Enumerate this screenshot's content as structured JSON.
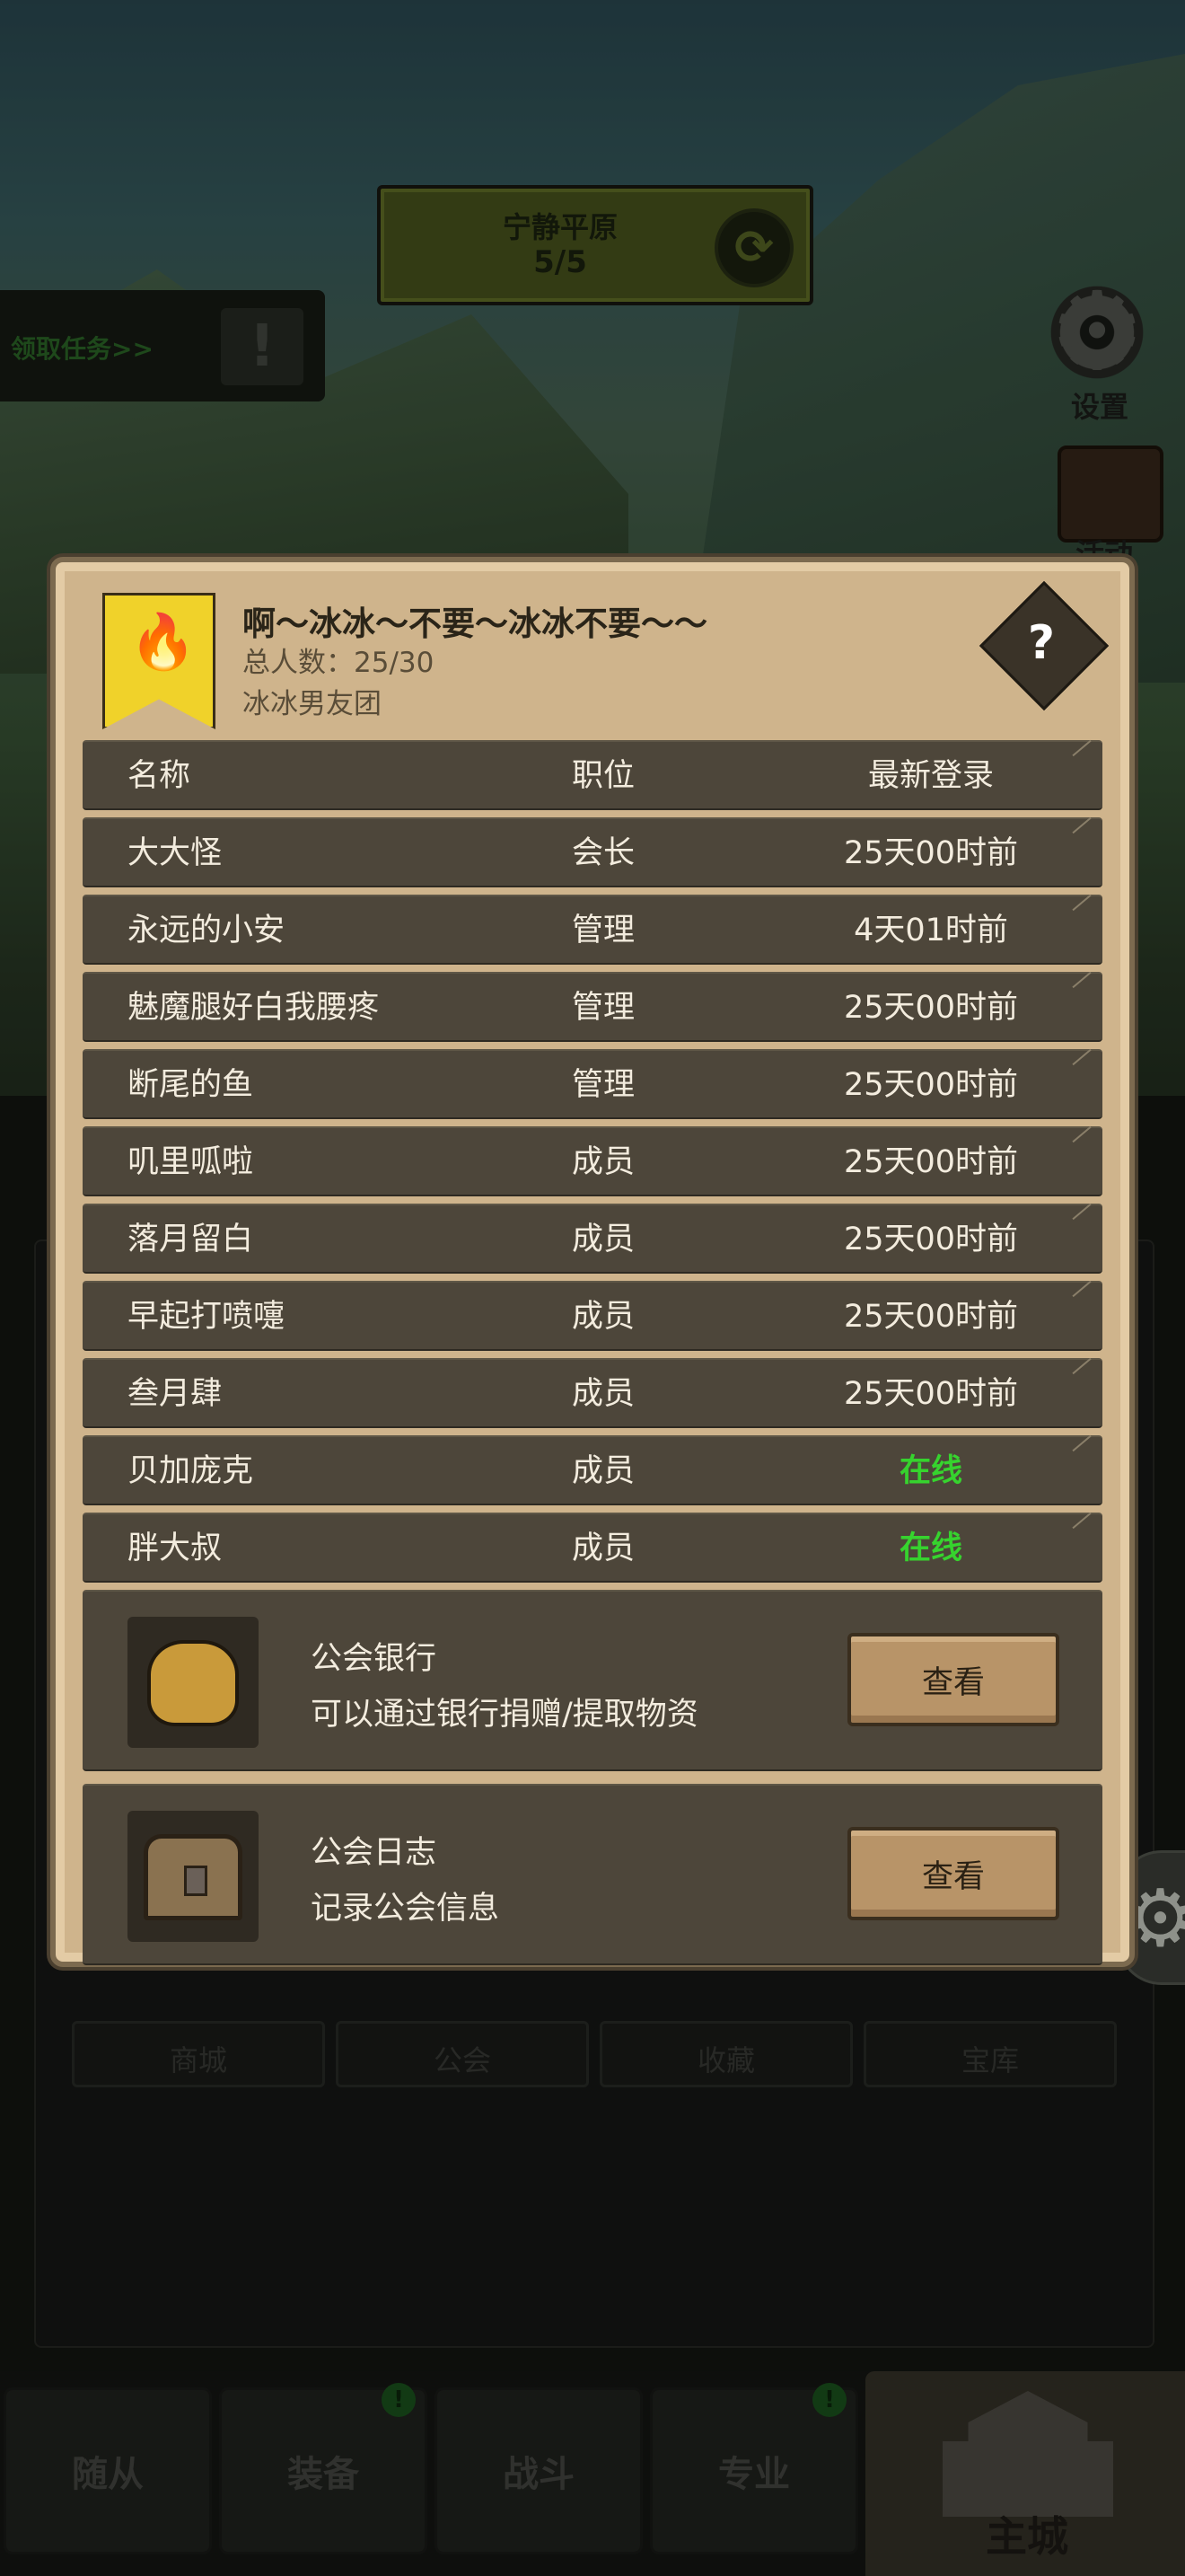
{
  "zone": {
    "title": "宁静平原",
    "progress": "5/5"
  },
  "quest": {
    "label": "领取任务>>"
  },
  "side": {
    "settings_label": "设置",
    "event_label": "活动"
  },
  "sub_tabs": [
    "商城",
    "公会",
    "收藏",
    "宝库"
  ],
  "bottom_nav": {
    "items": [
      "随从",
      "装备",
      "战斗",
      "专业"
    ],
    "badge": "!",
    "main": "主城"
  },
  "guild": {
    "name": "啊～冰冰～不要～冰冰不要～～",
    "member_count": "总人数：25/30",
    "subtitle": "冰冰男友团",
    "help": "?"
  },
  "table": {
    "headers": [
      "名称",
      "职位",
      "最新登录"
    ],
    "rows": [
      [
        "大大怪",
        "会长",
        "25天00时前"
      ],
      [
        "永远的小安",
        "管理",
        "4天01时前"
      ],
      [
        "魅魔腿好白我腰疼",
        "管理",
        "25天00时前"
      ],
      [
        "断尾的鱼",
        "管理",
        "25天00时前"
      ],
      [
        "叽里呱啦",
        "成员",
        "25天00时前"
      ],
      [
        "落月留白",
        "成员",
        "25天00时前"
      ],
      [
        "早起打喷嚏",
        "成员",
        "25天00时前"
      ],
      [
        "叁月肆",
        "成员",
        "25天00时前"
      ],
      [
        "贝加庞克",
        "成员",
        "在线"
      ],
      [
        "胖大叔",
        "成员",
        "在线"
      ]
    ]
  },
  "features": [
    {
      "title": "公会银行",
      "desc": "可以通过银行捐赠/提取物资",
      "button": "查看"
    },
    {
      "title": "公会日志",
      "desc": "记录公会信息",
      "button": "查看"
    }
  ],
  "colors": {
    "online": "#36d32e",
    "panel": "#cfb48c",
    "row": "#4d463a",
    "flag": "#f0d22a"
  }
}
